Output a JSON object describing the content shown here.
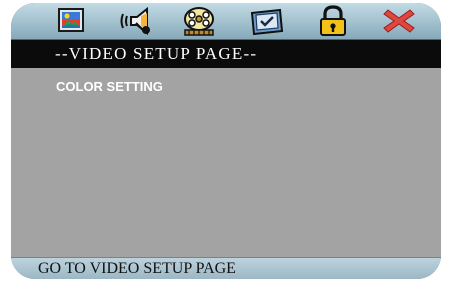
{
  "toolbar": {
    "icons": [
      {
        "name": "picture-icon",
        "selected": false
      },
      {
        "name": "speaker-icon",
        "selected": false
      },
      {
        "name": "film-reel-icon",
        "selected": false
      },
      {
        "name": "checkbox-monitor-icon",
        "selected": false
      },
      {
        "name": "padlock-icon",
        "selected": false
      },
      {
        "name": "exit-x-icon",
        "selected": false
      }
    ]
  },
  "title_bar": {
    "text": "--VIDEO SETUP PAGE--"
  },
  "menu": {
    "items": [
      {
        "label": "COLOR SETTING"
      }
    ]
  },
  "status_bar": {
    "text": "GO TO VIDEO SETUP PAGE"
  },
  "colors": {
    "toolbar_top": "#c2dbe5",
    "toolbar_bottom": "#86a9b9",
    "title_bg": "#0b0b0b",
    "panel_bg": "#a3a3a3",
    "exit_red": "#e0453f",
    "lock_yellow": "#f2c21a"
  }
}
